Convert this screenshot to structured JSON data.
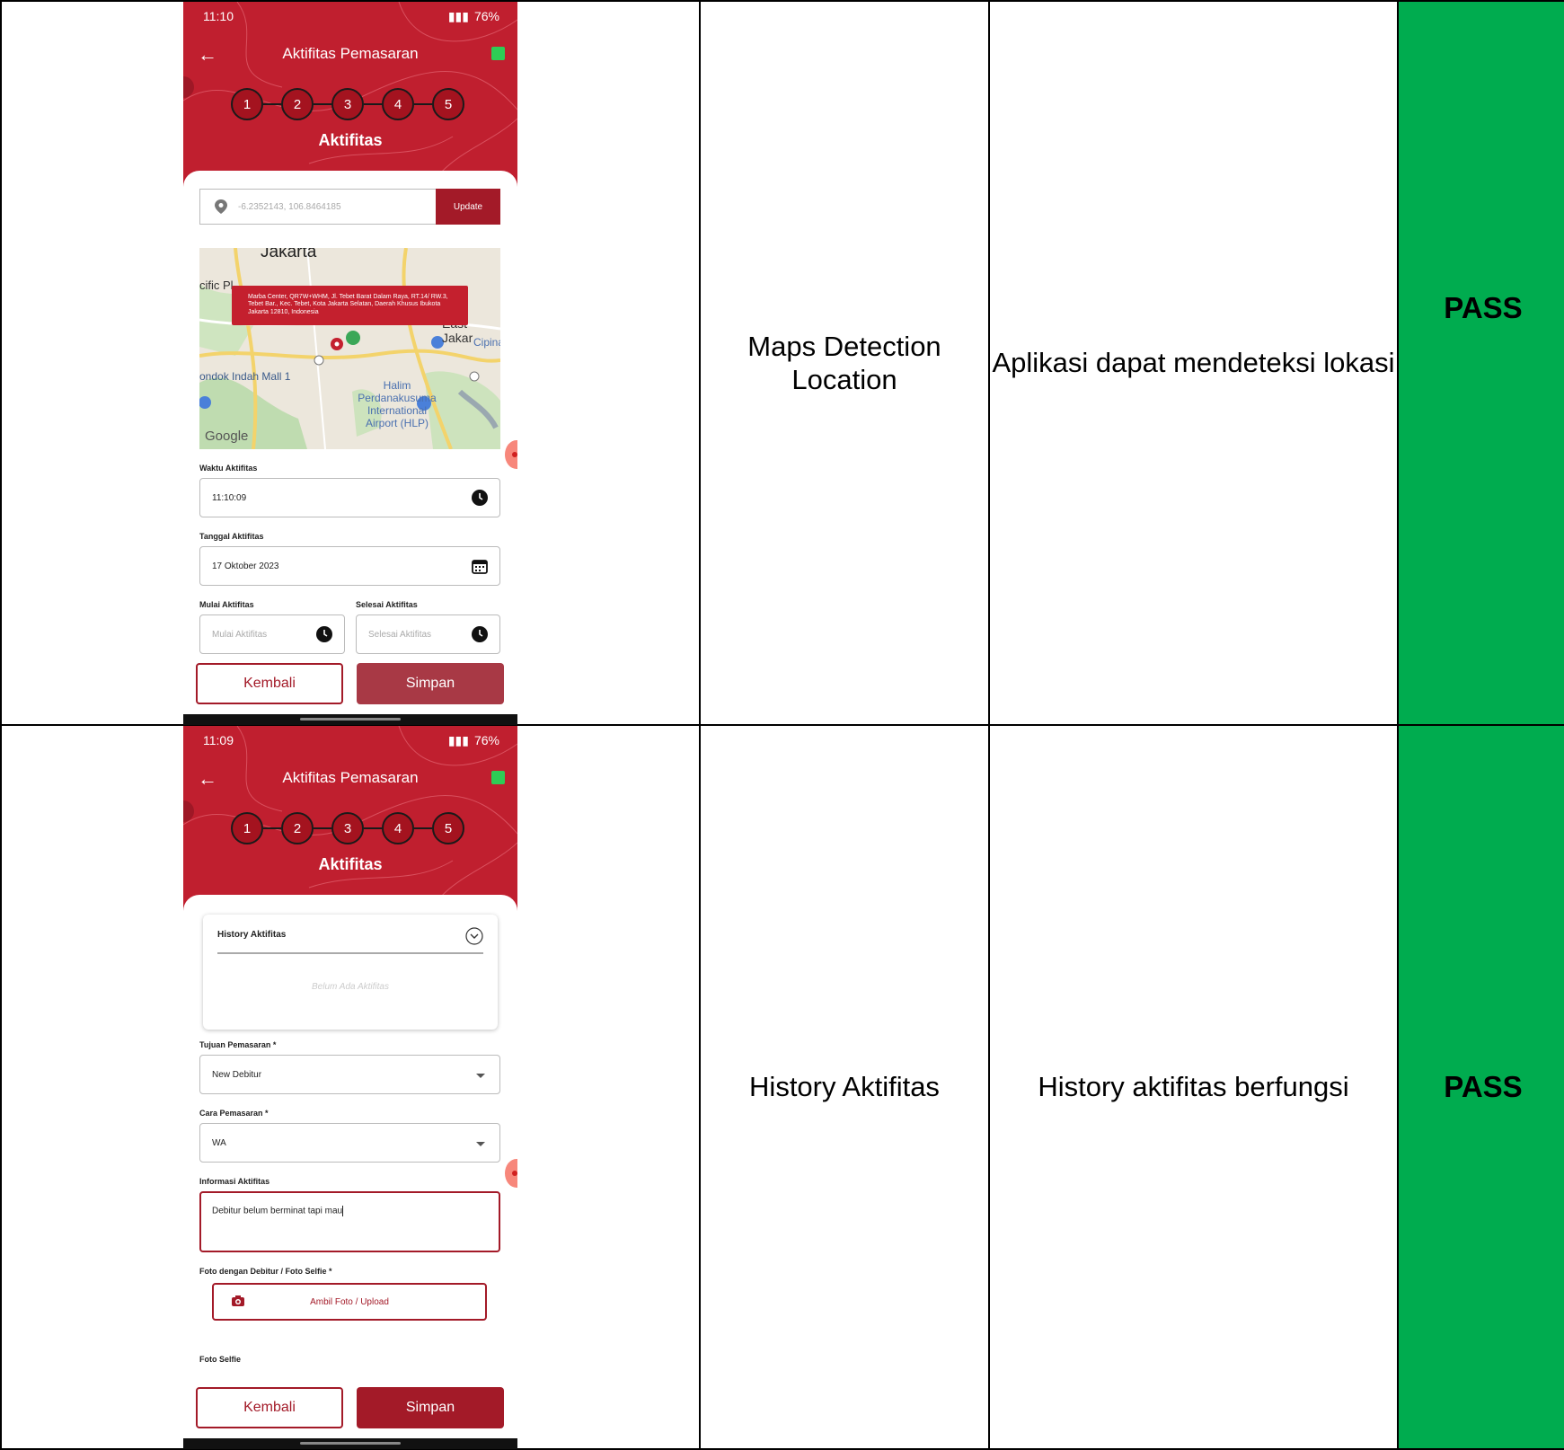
{
  "rows": [
    {
      "feature": "Maps Detection Location",
      "expected": "Aplikasi dapat mendeteksi lokasi",
      "result": "PASS",
      "phone": {
        "status_time": "11:10",
        "battery": "76%",
        "title": "Aktifitas Pemasaran",
        "steps": [
          "1",
          "2",
          "3",
          "4",
          "5"
        ],
        "step_name": "Aktifitas",
        "coord_value": "-6.2352143, 106.8464185",
        "update_label": "Update",
        "map": {
          "city": "Jakarta",
          "popup": "Marba Center, QR7W+WHM, Jl. Tebet Barat Dalam Raya, RT.14/ RW.3, Tebet Bar., Kec. Tebet, Kota Jakarta Selatan, Daerah Khusus Ibukota Jakarta 12810, Indonesia",
          "labels": [
            "cific Pl",
            "East Jakar",
            "Cipina",
            "ondok Indah Mall 1",
            "Halim Perdanakusuma International Airport (HLP)"
          ],
          "attribution": "Google"
        },
        "waktu_label": "Waktu Aktifitas",
        "waktu_value": "11:10:09",
        "tanggal_label": "Tanggal Aktifitas",
        "tanggal_value": "17 Oktober 2023",
        "mulai_label": "Mulai Aktifitas",
        "mulai_placeholder": "Mulai Aktifitas",
        "selesai_label": "Selesai Aktifitas",
        "selesai_placeholder": "Selesai Aktifitas",
        "back_label": "Kembali",
        "save_label": "Simpan"
      }
    },
    {
      "feature": "History Aktifitas",
      "expected": "History aktifitas berfungsi",
      "result": "PASS",
      "phone": {
        "status_time": "11:09",
        "battery": "76%",
        "title": "Aktifitas Pemasaran",
        "steps": [
          "1",
          "2",
          "3",
          "4",
          "5"
        ],
        "step_name": "Aktifitas",
        "history_title": "History Aktifitas",
        "history_empty": "Belum Ada Aktifitas",
        "tujuan_label": "Tujuan Pemasaran *",
        "tujuan_value": "New Debitur",
        "cara_label": "Cara Pemasaran *",
        "cara_value": "WA",
        "info_label": "Informasi Aktifitas",
        "info_value": "Debitur belum berminat tapi mau",
        "foto_label": "Foto dengan Debitur / Foto Selfie *",
        "foto_button": "Ambil Foto / Upload",
        "foto_selfie_label": "Foto Selfie",
        "back_label": "Kembali",
        "save_label": "Simpan"
      }
    }
  ],
  "colors": {
    "brand_red": "#c01f2f",
    "button_red": "#a31a28",
    "pass_green": "#00ac4f"
  }
}
